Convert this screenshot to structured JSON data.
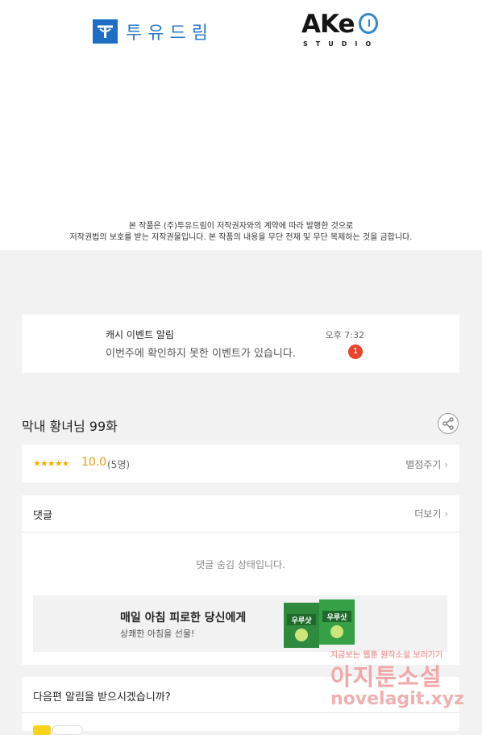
{
  "publisher": {
    "name": "투유드림",
    "studio_name": "AKEO",
    "studio_sub": "STUDIO"
  },
  "copyright": {
    "line1": "본 작품은 (주)투유드림이 저작권자와의 계약에 따라 발행한 것으로",
    "line2": "저작권법의 보호를 받는 저작권물입니다. 본 작품의 내용을 무단 전재 및 무단 복제하는 것을 금합니다."
  },
  "notification": {
    "title": "캐시 이벤트 알림",
    "message": "이번주에 확인하지 못한 이벤트가 있습니다.",
    "time": "오후 7:32",
    "badge": "1"
  },
  "episode": {
    "title": "막내 황녀님 99화",
    "share_icon": "share-icon"
  },
  "rating": {
    "stars": "★★★★★",
    "score": "10.0",
    "count": "(5명)",
    "action": "별점주기",
    "action_arrow": ">"
  },
  "comments": {
    "header": "댓글",
    "more": "더보기",
    "hidden_message": "댓글 숨김 상태입니다."
  },
  "ad": {
    "title": "매일 아침 피로한 당신에게",
    "subtitle": "상쾌한 아침을 선물!",
    "product_label": "우루사"
  },
  "next_notice": {
    "question": "다음편 알림을 받으시겠습니까?"
  },
  "watermark": {
    "line1": "지금보는 웹툰 원작소설 보러가기",
    "line2": "아지툰소설",
    "line3": "novelagit.xyz"
  },
  "colors": {
    "badge": "#e8452c",
    "score": "#e89a00",
    "stars": "#f2b100",
    "brand_blue": "#1c6fc4"
  }
}
